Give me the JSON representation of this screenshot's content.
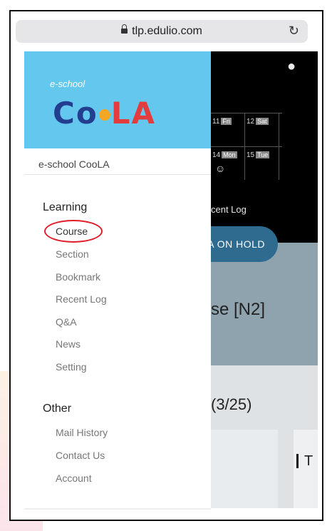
{
  "browser": {
    "url": "tlp.edulio.com"
  },
  "drawer": {
    "logo_small": "e-school",
    "logo_main_left": "Co",
    "logo_main_right": "LA",
    "app_name": "e-school CooLA",
    "sections": [
      {
        "title": "Learning",
        "items": [
          "Course",
          "Section",
          "Bookmark",
          "Recent Log",
          "Q&A",
          "News",
          "Setting"
        ]
      },
      {
        "title": "Other",
        "items": [
          "Mail History",
          "Contact Us",
          "Account"
        ]
      }
    ],
    "highlighted_item": "Course",
    "highlight_color": "#e01e2a",
    "logo_bg_color": "#64c8ee"
  },
  "background": {
    "calendar": [
      [
        {
          "day": "11",
          "dow": "Fri"
        },
        {
          "day": "12",
          "dow": "Sat"
        }
      ],
      [
        {
          "day": "14",
          "dow": "Mon"
        },
        {
          "day": "15",
          "dow": "Tue"
        }
      ]
    ],
    "recent_text": "cent Log",
    "hold_button": "A ON HOLD",
    "course_title": "se [N2]",
    "date_text": "(3/25)",
    "card_text": "T"
  }
}
